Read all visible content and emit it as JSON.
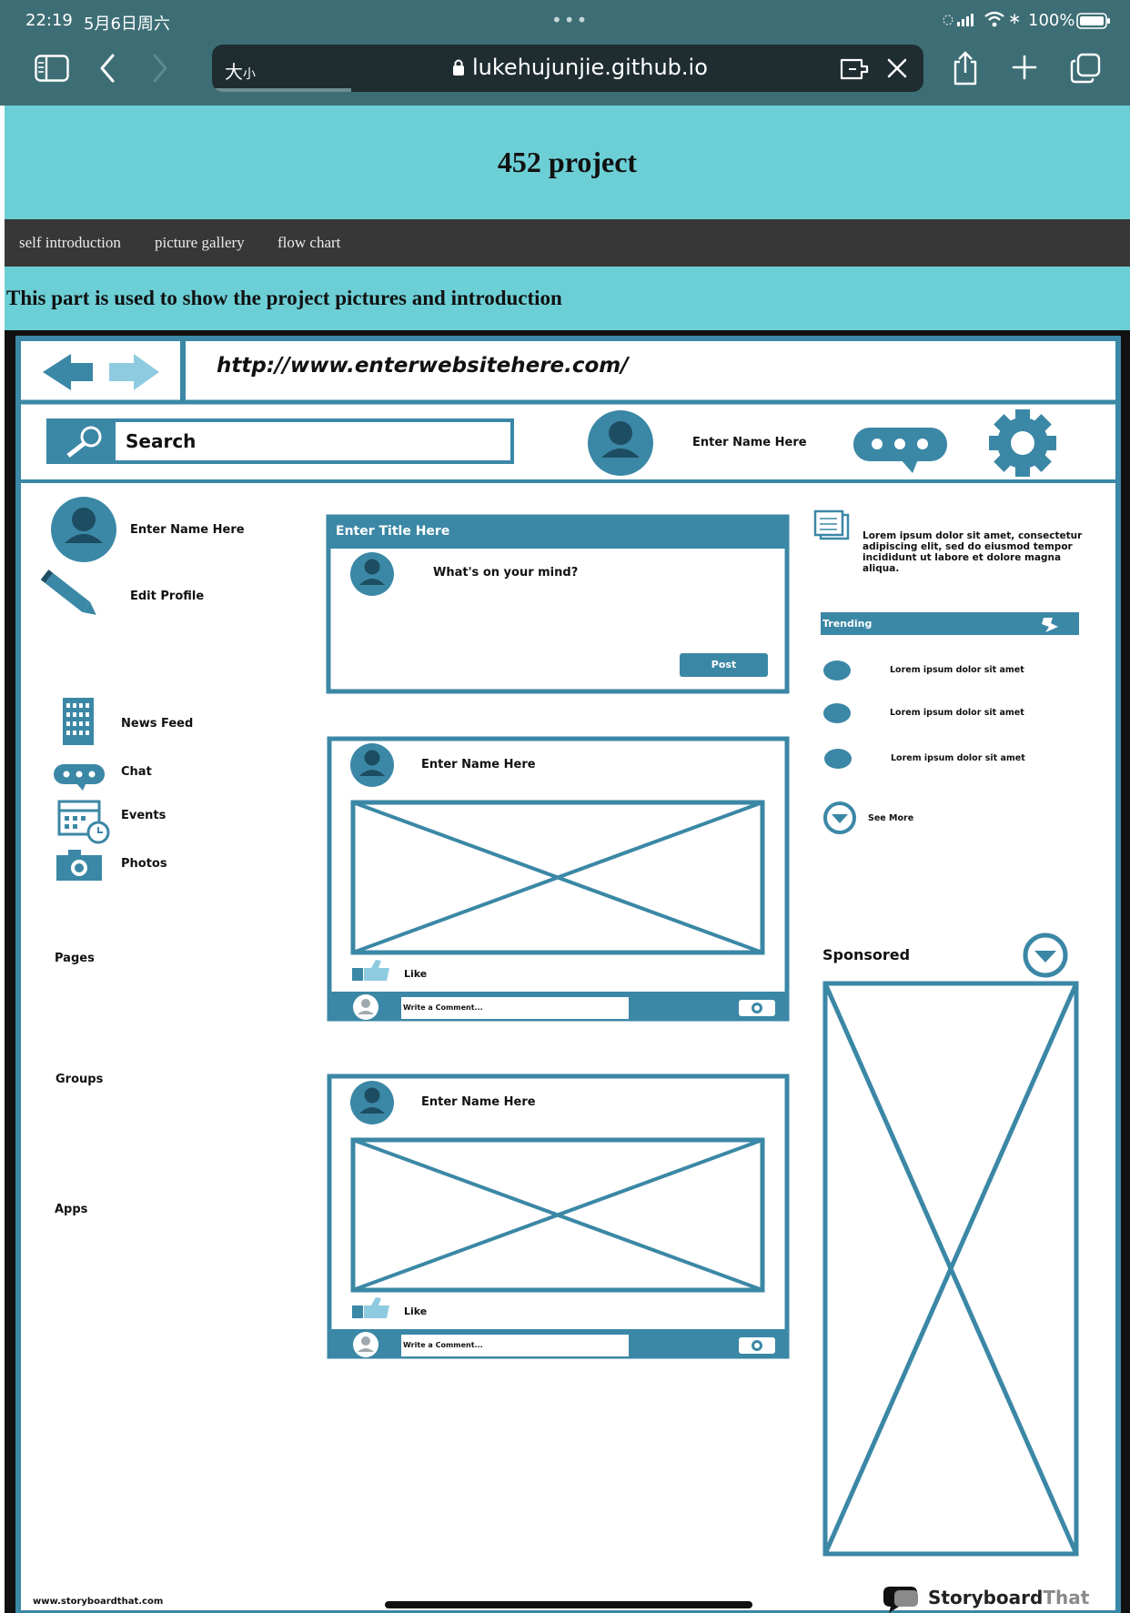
{
  "colors": {
    "browser_chrome": "#3e6e75",
    "address_bar": "#1f2d31",
    "site_header": "#6ccfd6",
    "site_nav": "#373737",
    "wireframe_blue": "#3b87a6",
    "wireframe_arrow_light": "#8fcbe0"
  },
  "status_bar": {
    "time": "22:19",
    "date": "5月6日周六",
    "dots": "•••",
    "battery": "100%"
  },
  "browser": {
    "text_size_label": "大",
    "text_size_label_small": "小",
    "url": "lukehujunjie.github.io"
  },
  "site": {
    "title": "452 project",
    "nav": [
      "self introduction",
      "picture gallery",
      "flow chart"
    ],
    "intro": "This part is used to show the project pictures and introduction"
  },
  "wireframe": {
    "url": "http://www.enterwebsitehere.com/",
    "search_label": "Search",
    "header_name": "Enter Name Here",
    "left": {
      "profile_name": "Enter Name Here",
      "edit_profile": "Edit Profile",
      "menu": [
        "News Feed",
        "Chat",
        "Events",
        "Photos"
      ],
      "sections": [
        "Pages",
        "Groups",
        "Apps"
      ]
    },
    "composer": {
      "title": "Enter Title Here",
      "prompt": "What's on your mind?",
      "post_button": "Post"
    },
    "posts": [
      {
        "name": "Enter Name Here",
        "like": "Like",
        "comment_placeholder": "Write a Comment..."
      },
      {
        "name": "Enter Name Here",
        "like": "Like",
        "comment_placeholder": "Write a Comment..."
      }
    ],
    "right": {
      "lorem": "Lorem ipsum dolor sit amet, consectetur adipiscing elit, sed do eiusmod tempor incididunt ut labore et dolore magna aliqua.",
      "trending_label": "Trending",
      "trending_items": [
        "Lorem ipsum dolor sit amet",
        "Lorem ipsum dolor sit amet",
        "Lorem ipsum dolor sit amet"
      ],
      "see_more": "See More",
      "sponsored": "Sponsored"
    },
    "footer_left": "www.storyboardthat.com",
    "footer_logo_a": "Storyboard",
    "footer_logo_b": "That"
  }
}
